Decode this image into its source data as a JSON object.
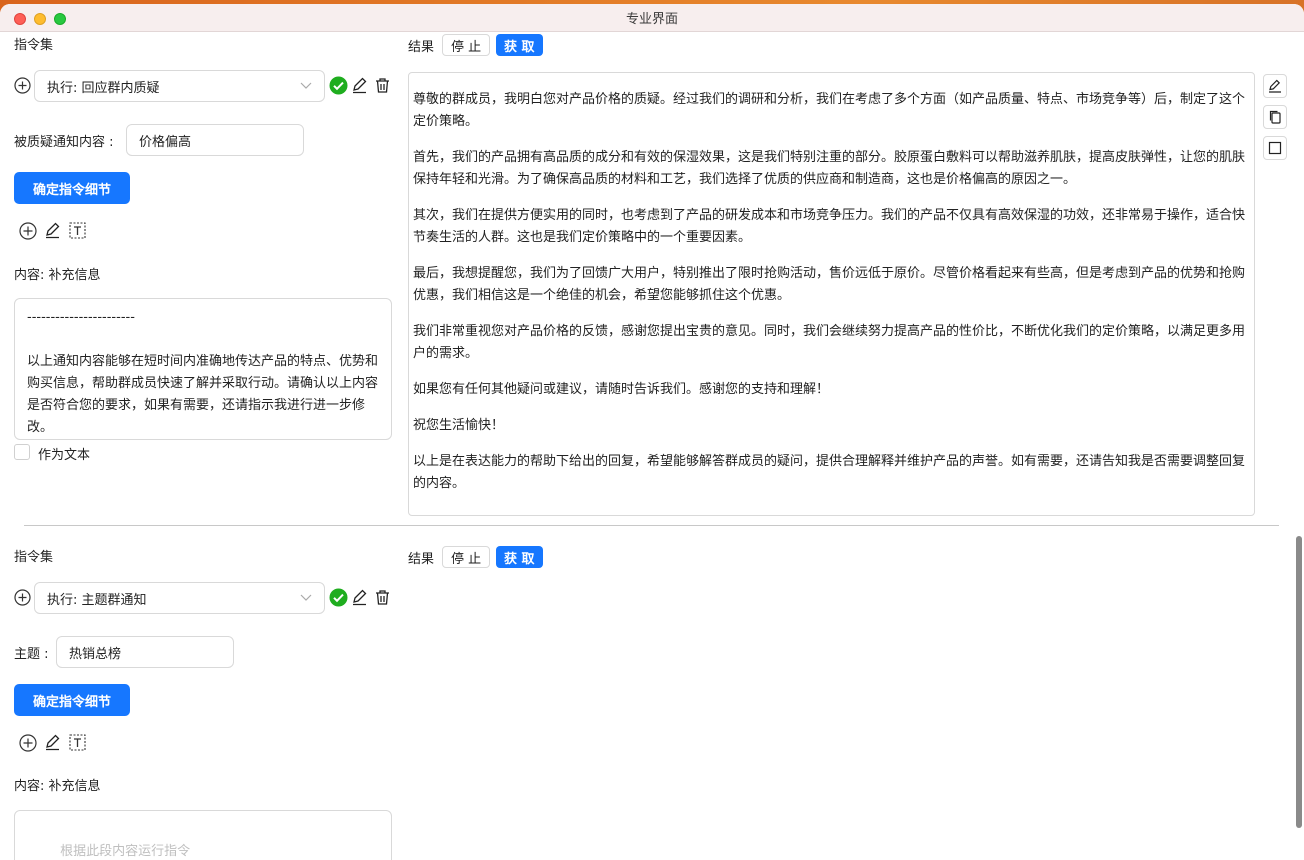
{
  "window": {
    "title": "专业界面"
  },
  "blocks": [
    {
      "instruction_set_label": "指令集",
      "result_label": "结果",
      "stop_label": "停 止",
      "fetch_label": "获 取",
      "select_value": "执行: 回应群内质疑",
      "field_label": "被质疑通知内容 :",
      "field_value": "价格偏高",
      "confirm_label": "确定指令细节",
      "content_label": "内容: 补充信息",
      "textarea_text": "-----------------------\n\n以上通知内容能够在短时间内准确地传达产品的特点、优势和购买信息，帮助群成员快速了解并采取行动。请确认以上内容是否符合您的要求，如果有需要，还请指示我进行进一步修改。",
      "as_text_label": "作为文本",
      "result_paragraphs": [
        "尊敬的群成员，我明白您对产品价格的质疑。经过我们的调研和分析，我们在考虑了多个方面（如产品质量、特点、市场竞争等）后，制定了这个定价策略。",
        "首先，我们的产品拥有高品质的成分和有效的保湿效果，这是我们特别注重的部分。胶原蛋白敷料可以帮助滋养肌肤，提高皮肤弹性，让您的肌肤保持年轻和光滑。为了确保高品质的材料和工艺，我们选择了优质的供应商和制造商，这也是价格偏高的原因之一。",
        "其次，我们在提供方便实用的同时，也考虑到了产品的研发成本和市场竞争压力。我们的产品不仅具有高效保湿的功效，还非常易于操作，适合快节奏生活的人群。这也是我们定价策略中的一个重要因素。",
        "最后，我想提醒您，我们为了回馈广大用户，特别推出了限时抢购活动，售价远低于原价。尽管价格看起来有些高，但是考虑到产品的优势和抢购优惠，我们相信这是一个绝佳的机会，希望您能够抓住这个优惠。",
        "我们非常重视您对产品价格的反馈，感谢您提出宝贵的意见。同时，我们会继续努力提高产品的性价比，不断优化我们的定价策略，以满足更多用户的需求。",
        "如果您有任何其他疑问或建议，请随时告诉我们。感谢您的支持和理解！",
        "祝您生活愉快！",
        "以上是在表达能力的帮助下给出的回复，希望能够解答群成员的疑问，提供合理解释并维护产品的声誉。如有需要，还请告知我是否需要调整回复的内容。"
      ]
    },
    {
      "instruction_set_label": "指令集",
      "result_label": "结果",
      "stop_label": "停 止",
      "fetch_label": "获 取",
      "select_value": "执行: 主题群通知",
      "field_label": "主题 :",
      "field_value": "热销总榜",
      "confirm_label": "确定指令细节",
      "content_label": "内容: 补充信息",
      "textarea_placeholder": "根据此段内容运行指令"
    }
  ],
  "colors": {
    "primary": "#1677ff",
    "success": "#1fad1f"
  }
}
